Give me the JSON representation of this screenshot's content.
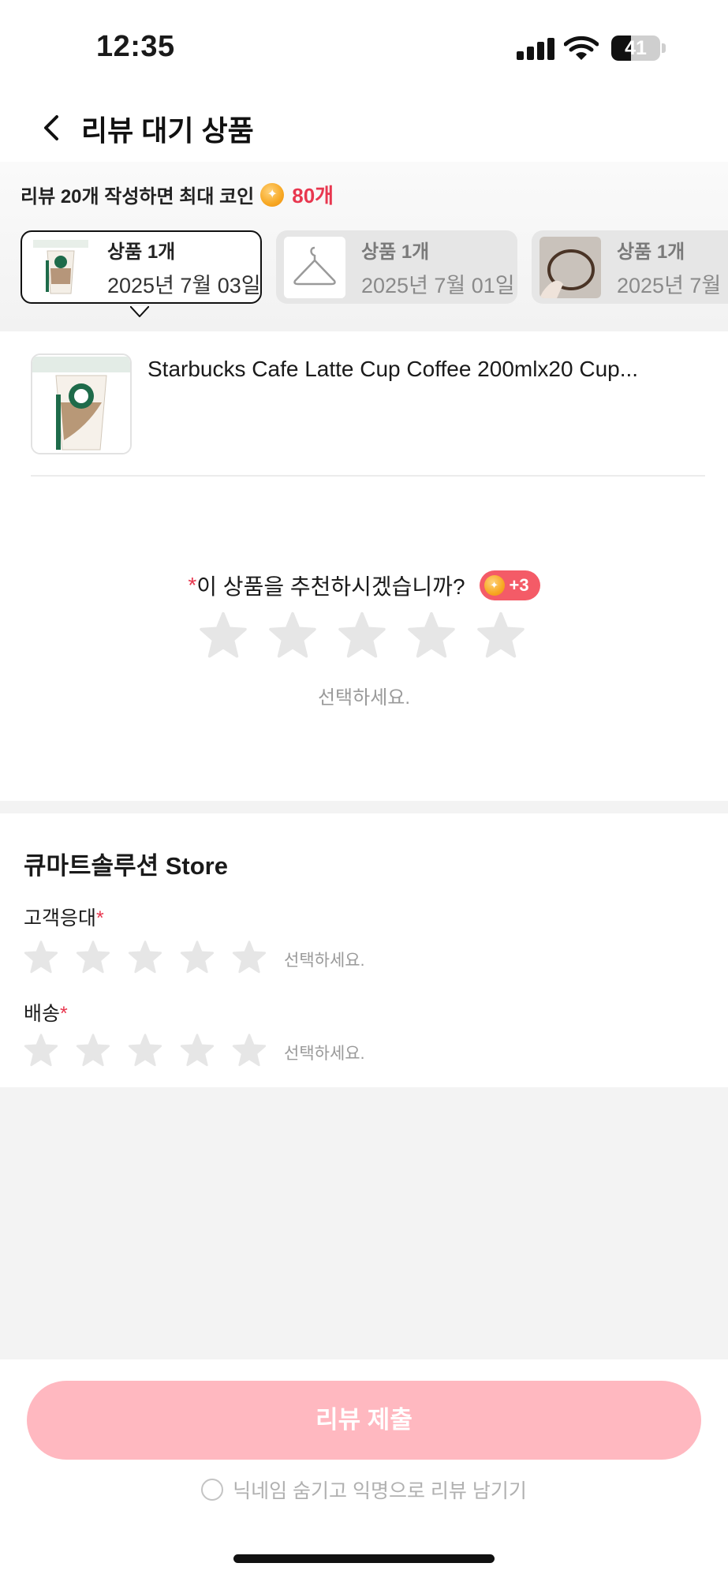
{
  "status_bar": {
    "time": "12:35",
    "battery": "41",
    "battery_level": 0.41,
    "icons": [
      "signal-icon",
      "wifi-icon",
      "battery-icon"
    ]
  },
  "header": {
    "back_icon": "chevron-left-icon",
    "title": "리뷰 대기 상품"
  },
  "reward": {
    "text": "리뷰 20개 작성하면 최대 코인",
    "amount": "80개",
    "icon": "coin-icon"
  },
  "tabs": [
    {
      "label": "상품 1개",
      "date": "2025년 7월 03일",
      "active": true
    },
    {
      "label": "상품 1개",
      "date": "2025년 7월 01일",
      "active": false
    },
    {
      "label": "상품 1개",
      "date": "2025년 7월",
      "active": false
    }
  ],
  "product": {
    "name": "Starbucks Cafe Latte Cup Coffee 200mlx20 Cup..."
  },
  "recommend": {
    "required_mark": "*",
    "question": "이 상품을 추천하시겠습니까?",
    "bonus": "+3",
    "rating": 0,
    "max_rating": 5,
    "hint": "선택하세요."
  },
  "store": {
    "title": "큐마트솔루션 Store",
    "ratings": [
      {
        "label": "고객응대",
        "required_mark": "*",
        "rating": 0,
        "max_rating": 5,
        "hint": "선택하세요."
      },
      {
        "label": "배송",
        "required_mark": "*",
        "rating": 0,
        "max_rating": 5,
        "hint": "선택하세요."
      }
    ]
  },
  "submit": {
    "label": "리뷰 제출"
  },
  "anonymous": {
    "label": "닉네임 숨기고 익명으로 리뷰 남기기",
    "checked": false
  },
  "colors": {
    "accent": "#e8374f",
    "submit_disabled": "#ffb8c0",
    "badge": "#f45b67",
    "star_empty": "#e6e6e6"
  }
}
